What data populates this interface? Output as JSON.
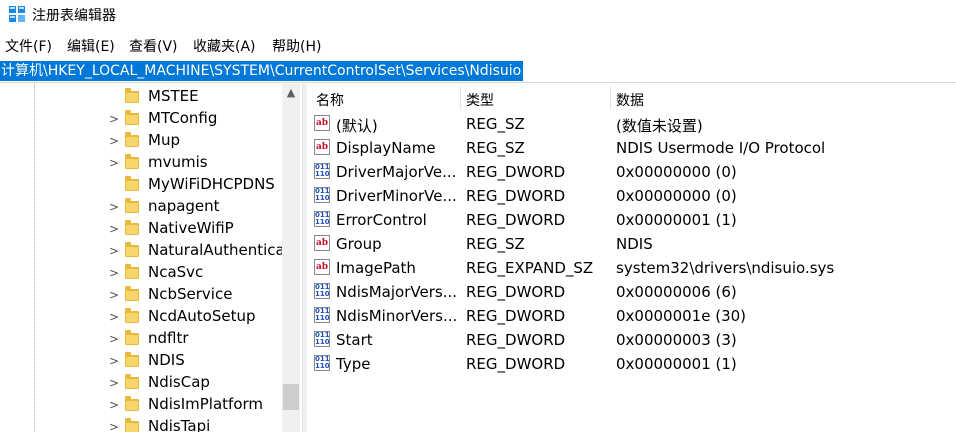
{
  "window": {
    "title": "注册表编辑器",
    "icon": "registry-editor-icon"
  },
  "menu": [
    {
      "label": "文件(F)"
    },
    {
      "label": "编辑(E)"
    },
    {
      "label": "查看(V)"
    },
    {
      "label": "收藏夹(A)"
    },
    {
      "label": "帮助(H)"
    }
  ],
  "address": "计算机\\HKEY_LOCAL_MACHINE\\SYSTEM\\CurrentControlSet\\Services\\Ndisuio",
  "tree": [
    {
      "label": "MSTEE",
      "has_children": false
    },
    {
      "label": "MTConfig",
      "has_children": true
    },
    {
      "label": "Mup",
      "has_children": true
    },
    {
      "label": "mvumis",
      "has_children": true
    },
    {
      "label": "MyWiFiDHCPDNS",
      "has_children": false
    },
    {
      "label": "napagent",
      "has_children": true
    },
    {
      "label": "NativeWifiP",
      "has_children": true
    },
    {
      "label": "NaturalAuthentica",
      "has_children": true
    },
    {
      "label": "NcaSvc",
      "has_children": true
    },
    {
      "label": "NcbService",
      "has_children": true
    },
    {
      "label": "NcdAutoSetup",
      "has_children": true
    },
    {
      "label": "ndfltr",
      "has_children": true
    },
    {
      "label": "NDIS",
      "has_children": true
    },
    {
      "label": "NdisCap",
      "has_children": true
    },
    {
      "label": "NdisImPlatform",
      "has_children": true
    },
    {
      "label": "NdisTapi",
      "has_children": true
    }
  ],
  "columns": {
    "name": "名称",
    "type": "类型",
    "data": "数据"
  },
  "values": [
    {
      "icon": "string-value-icon",
      "name": "(默认)",
      "type": "REG_SZ",
      "data": "(数值未设置)"
    },
    {
      "icon": "string-value-icon",
      "name": "DisplayName",
      "type": "REG_SZ",
      "data": "NDIS Usermode I/O Protocol"
    },
    {
      "icon": "binary-value-icon",
      "name": "DriverMajorVe...",
      "type": "REG_DWORD",
      "data": "0x00000000 (0)"
    },
    {
      "icon": "binary-value-icon",
      "name": "DriverMinorVe...",
      "type": "REG_DWORD",
      "data": "0x00000000 (0)"
    },
    {
      "icon": "binary-value-icon",
      "name": "ErrorControl",
      "type": "REG_DWORD",
      "data": "0x00000001 (1)"
    },
    {
      "icon": "string-value-icon",
      "name": "Group",
      "type": "REG_SZ",
      "data": "NDIS"
    },
    {
      "icon": "string-value-icon",
      "name": "ImagePath",
      "type": "REG_EXPAND_SZ",
      "data": "system32\\drivers\\ndisuio.sys"
    },
    {
      "icon": "binary-value-icon",
      "name": "NdisMajorVers...",
      "type": "REG_DWORD",
      "data": "0x00000006 (6)"
    },
    {
      "icon": "binary-value-icon",
      "name": "NdisMinorVers...",
      "type": "REG_DWORD",
      "data": "0x0000001e (30)"
    },
    {
      "icon": "binary-value-icon",
      "name": "Start",
      "type": "REG_DWORD",
      "data": "0x00000003 (3)"
    },
    {
      "icon": "binary-value-icon",
      "name": "Type",
      "type": "REG_DWORD",
      "data": "0x00000001 (1)"
    }
  ],
  "colors": {
    "selection": "#0078d7",
    "folder": "#e8b93c",
    "string_icon": "#c8102e",
    "binary_icon": "#1f4fbf"
  }
}
